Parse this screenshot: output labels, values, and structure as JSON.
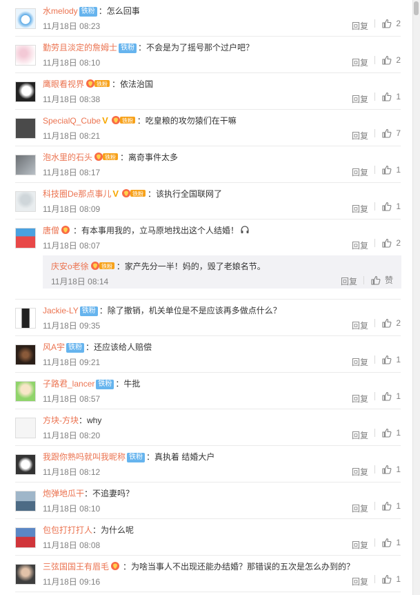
{
  "ui": {
    "reply_label": "回复",
    "fan_badge": "铁粉",
    "like_zan": "赞"
  },
  "comments": [
    {
      "name": "水melody",
      "badge": "tie",
      "text": "：怎么回事",
      "time": "11月18日 08:23",
      "likes": "2",
      "avatar": "cloud"
    },
    {
      "name": "勤劳且淡定的詹姆士",
      "badge": "tie",
      "text": "：不会是为了摇号那个过户吧？",
      "time": "11月18日 08:10",
      "likes": "2",
      "avatar": "flower"
    },
    {
      "name": "鹰眼看视界",
      "badge": "fan",
      "text": "：依法治国",
      "time": "11月18日 08:38",
      "likes": "1",
      "avatar": "eagle"
    },
    {
      "name": "SpecialQ_Cube",
      "badge": "vfan",
      "text": "：吃皇粮的攻勿猿们在干嘛",
      "time": "11月18日 08:21",
      "likes": "7",
      "avatar": "grey"
    },
    {
      "name": "泡水里的石头",
      "badge": "fan",
      "text": "：离奇事件太多",
      "time": "11月18日 08:17",
      "likes": "1",
      "avatar": "stone"
    },
    {
      "name": "科技圈De那点事儿",
      "badge": "vfan",
      "text": "：该执行全国联网了",
      "time": "11月18日 08:09",
      "likes": "1",
      "avatar": "tech"
    },
    {
      "name": "唐僧",
      "badge": "fanonly",
      "text": "：有本事用我的，立马原地找出这个人结婚！",
      "time": "11月18日 08:07",
      "likes": "2",
      "avatar": "monk",
      "reply": {
        "name": "庆安o老徐",
        "text": "：家产先分一半！妈的，毁了老娘名节。",
        "time": "11月18日 08:14"
      }
    },
    {
      "name": "Jackie-LY",
      "badge": "tie",
      "text": "：除了撤销，机关单位是不是应该再多做点什么？",
      "time": "11月18日 09:35",
      "likes": "2",
      "avatar": "jackie"
    },
    {
      "name": "风A宇",
      "badge": "tie",
      "text": "：还应该给人赔偿",
      "time": "11月18日 09:21",
      "likes": "1",
      "avatar": "wind"
    },
    {
      "name": "子路君_lancer",
      "badge": "tie",
      "text": "：牛批",
      "time": "11月18日 08:57",
      "likes": "1",
      "avatar": "anime"
    },
    {
      "name": "方块-方块",
      "badge": "none",
      "text": "：why",
      "time": "11月18日 08:20",
      "likes": "1",
      "avatar": "paper"
    },
    {
      "name": "我跟你熟吗就叫我昵称",
      "badge": "tie",
      "text": "：真执着 结婚大户",
      "time": "11月18日 08:12",
      "likes": "1",
      "avatar": "dog"
    },
    {
      "name": "炮弹地瓜干",
      "badge": "none",
      "text": "：不追妻吗？",
      "time": "11月18日 08:10",
      "likes": "1",
      "avatar": "sea"
    },
    {
      "name": "包包打打打人",
      "badge": "none",
      "text": "：为什么呢",
      "time": "11月18日 08:08",
      "likes": "1",
      "avatar": "car"
    },
    {
      "name": "三弦国国王有眉毛",
      "badge": "fanonly",
      "text": "：为啥当事人不出现还能办结婚？那错误的五次是怎么办到的？",
      "time": "11月18日 09:16",
      "likes": "1",
      "avatar": "man"
    }
  ]
}
